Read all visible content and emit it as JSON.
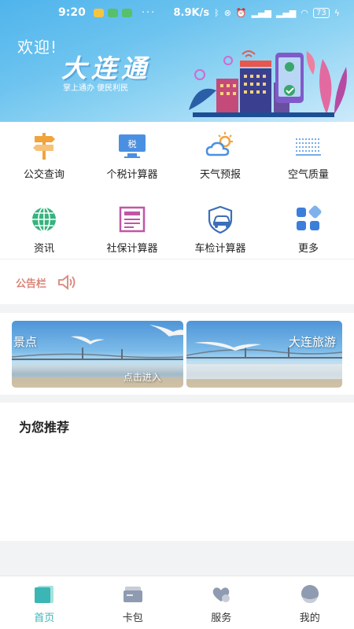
{
  "status_bar": {
    "time": "9:20",
    "dots": "···",
    "speed": "8.9K/s",
    "battery": "73",
    "notification_colors": [
      "#f5c542",
      "#57c06b",
      "#57c06b"
    ]
  },
  "banner": {
    "welcome": "欢迎!",
    "title": "大连通",
    "slogan": "掌上通办 便民利民"
  },
  "services": [
    {
      "label": "公交查询",
      "icon": "bus-signpost-icon",
      "color": "#f0a43c"
    },
    {
      "label": "个税计算器",
      "icon": "tax-monitor-icon",
      "color": "#4a90e2",
      "glyph": "税"
    },
    {
      "label": "天气预报",
      "icon": "weather-icon",
      "color": "#4a90e2"
    },
    {
      "label": "空气质量",
      "icon": "air-quality-icon",
      "color": "#4a90e2"
    },
    {
      "label": "资讯",
      "icon": "globe-icon",
      "color": "#36b37e"
    },
    {
      "label": "社保计算器",
      "icon": "social-security-icon",
      "color": "#c056a7"
    },
    {
      "label": "车检计算器",
      "icon": "car-inspection-icon",
      "color": "#3b6fb6"
    },
    {
      "label": "更多",
      "icon": "more-grid-icon",
      "color": "#3b7fd9"
    }
  ],
  "notice": {
    "label": "公告栏"
  },
  "scenic": [
    {
      "title": "景点",
      "action": "点击进入"
    },
    {
      "title": "大连旅游"
    }
  ],
  "recommend": {
    "title": "为您推荐"
  },
  "tabs": [
    {
      "label": "首页",
      "icon": "home-icon",
      "active": true
    },
    {
      "label": "卡包",
      "icon": "wallet-icon",
      "active": false
    },
    {
      "label": "服务",
      "icon": "heart-hand-icon",
      "active": false
    },
    {
      "label": "我的",
      "icon": "profile-icon",
      "active": false
    }
  ],
  "colors": {
    "accent": "#3bb6b5",
    "notice": "#d9867a",
    "banner_blue": "#4fb4ec"
  }
}
